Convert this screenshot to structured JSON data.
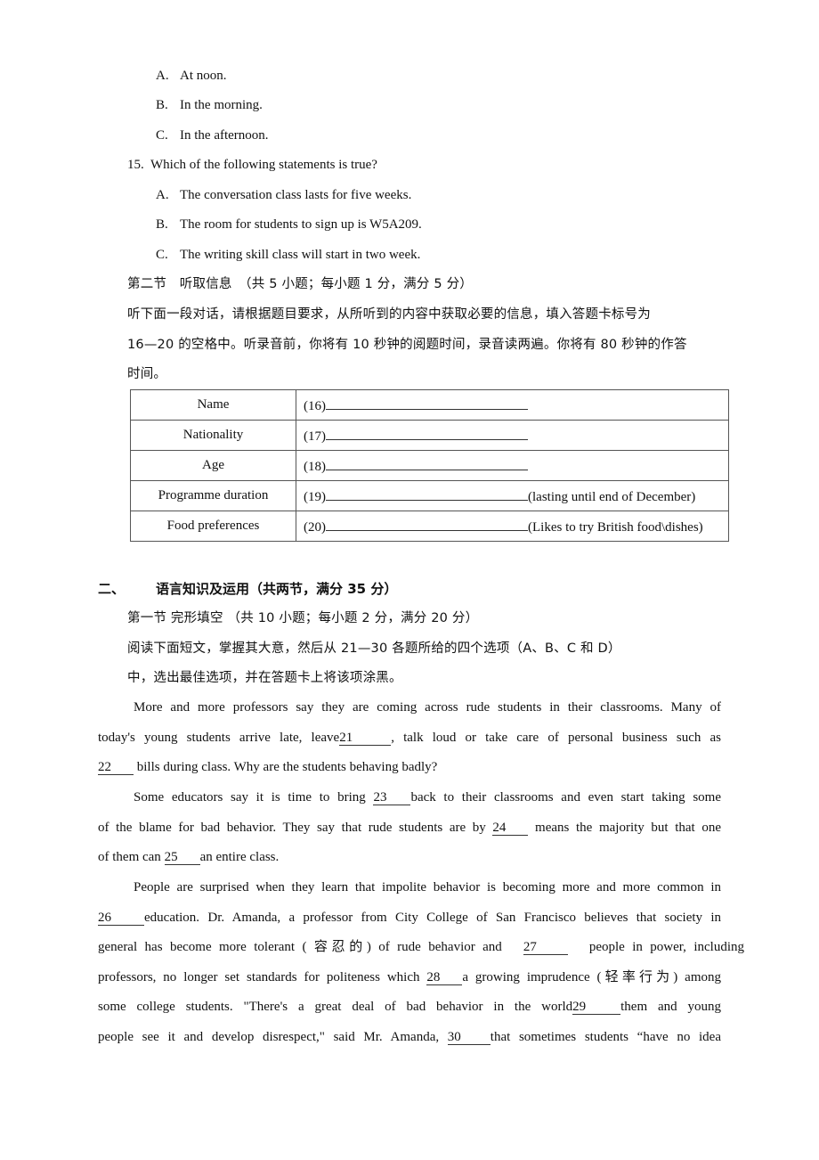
{
  "q14_options": [
    {
      "letter": "A.",
      "text": "At noon."
    },
    {
      "letter": "B.",
      "text": "In the morning."
    },
    {
      "letter": "C.",
      "text": "In the afternoon."
    }
  ],
  "q15": {
    "number": "15.",
    "stem": "Which of the following statements is true?",
    "options": [
      {
        "letter": "A.",
        "text": "The conversation class lasts for five weeks."
      },
      {
        "letter": "B.",
        "text": "The room for students to sign up is W5A209."
      },
      {
        "letter": "C.",
        "text": "The writing skill class will start in two week."
      }
    ]
  },
  "section2": {
    "title": "第二节　听取信息　（共 5 小题；每小题 1 分，满分 5 分）",
    "instructions_lines": [
      "听下面一段对话，请根据题目要求，从所听到的内容中获取必要的信息，填入答题卡标号为",
      "16—20  的空格中。听录音前，你将有 10 秒钟的阅题时间，录音读两遍。你将有 80 秒钟的作答",
      "时间。"
    ]
  },
  "info_table": {
    "rows": [
      {
        "label": "Name",
        "blank": "(16)",
        "note": ""
      },
      {
        "label": "Nationality",
        "blank": "(17)",
        "note": ""
      },
      {
        "label": "Age",
        "blank": "(18)",
        "note": ""
      },
      {
        "label": "Programme duration",
        "blank": "(19)",
        "note": "(lasting until end of December)"
      },
      {
        "label": "Food preferences",
        "blank": "(20)",
        "note": "(Likes to try British food\\dishes)"
      }
    ]
  },
  "part2": {
    "number": "二、",
    "title": "语言知识及运用（共两节，满分 35 分）",
    "subsection_title": "第一节 完形填空 （共 10 小题；每小题 2 分，满分 20 分）",
    "instructions_lines": [
      "阅读下面短文，掌握其大意，然后从 21—30 各题所给的四个选项（A、B、C 和 D）",
      "中，选出最佳选项，并在答题卡上将该项涂黑。"
    ]
  },
  "passage": {
    "p1": {
      "l1": "More and more professors say they are coming across rude students in their classrooms. Many of",
      "l2a": "today's young students arrive late, leave",
      "b21": "21",
      "l2b": ", talk loud or take care of personal business such as",
      "b22": "22",
      "l3b": " bills during class. Why are the students behaving badly?"
    },
    "p2": {
      "l1a": "Some educators say it is time to bring ",
      "b23": "23",
      "l1b": "back to their classrooms and even start taking some",
      "l2a": "of the blame for bad behavior. They say that rude students are by ",
      "b24": "24",
      "l2b": " means the majority but that one",
      "l3a": "of them can ",
      "b25": "25",
      "l3b": "an entire class."
    },
    "p3": {
      "l1": "People are surprised when they learn that impolite behavior is becoming more and more common in",
      "b26": "26",
      "l2b": "education. Dr. Amanda, a professor from City College of San Francisco believes that society in",
      "l3a": "general has become more tolerant ( 容忍的) of rude behavior and",
      "b27": "27",
      "l3b": "people in power, including",
      "l4a": "professors, no longer set standards for politeness which ",
      "b28": "28",
      "l4b": "a growing imprudence (轻率行为) among",
      "l5a": "some college students. \"There's a great deal of bad behavior in the world",
      "b29": "29",
      "l5b": "them and young",
      "l6a": "people see it and develop disrespect,\" said Mr. Amanda, ",
      "b30": "30",
      "l6b": "that sometimes students “have no idea"
    }
  }
}
